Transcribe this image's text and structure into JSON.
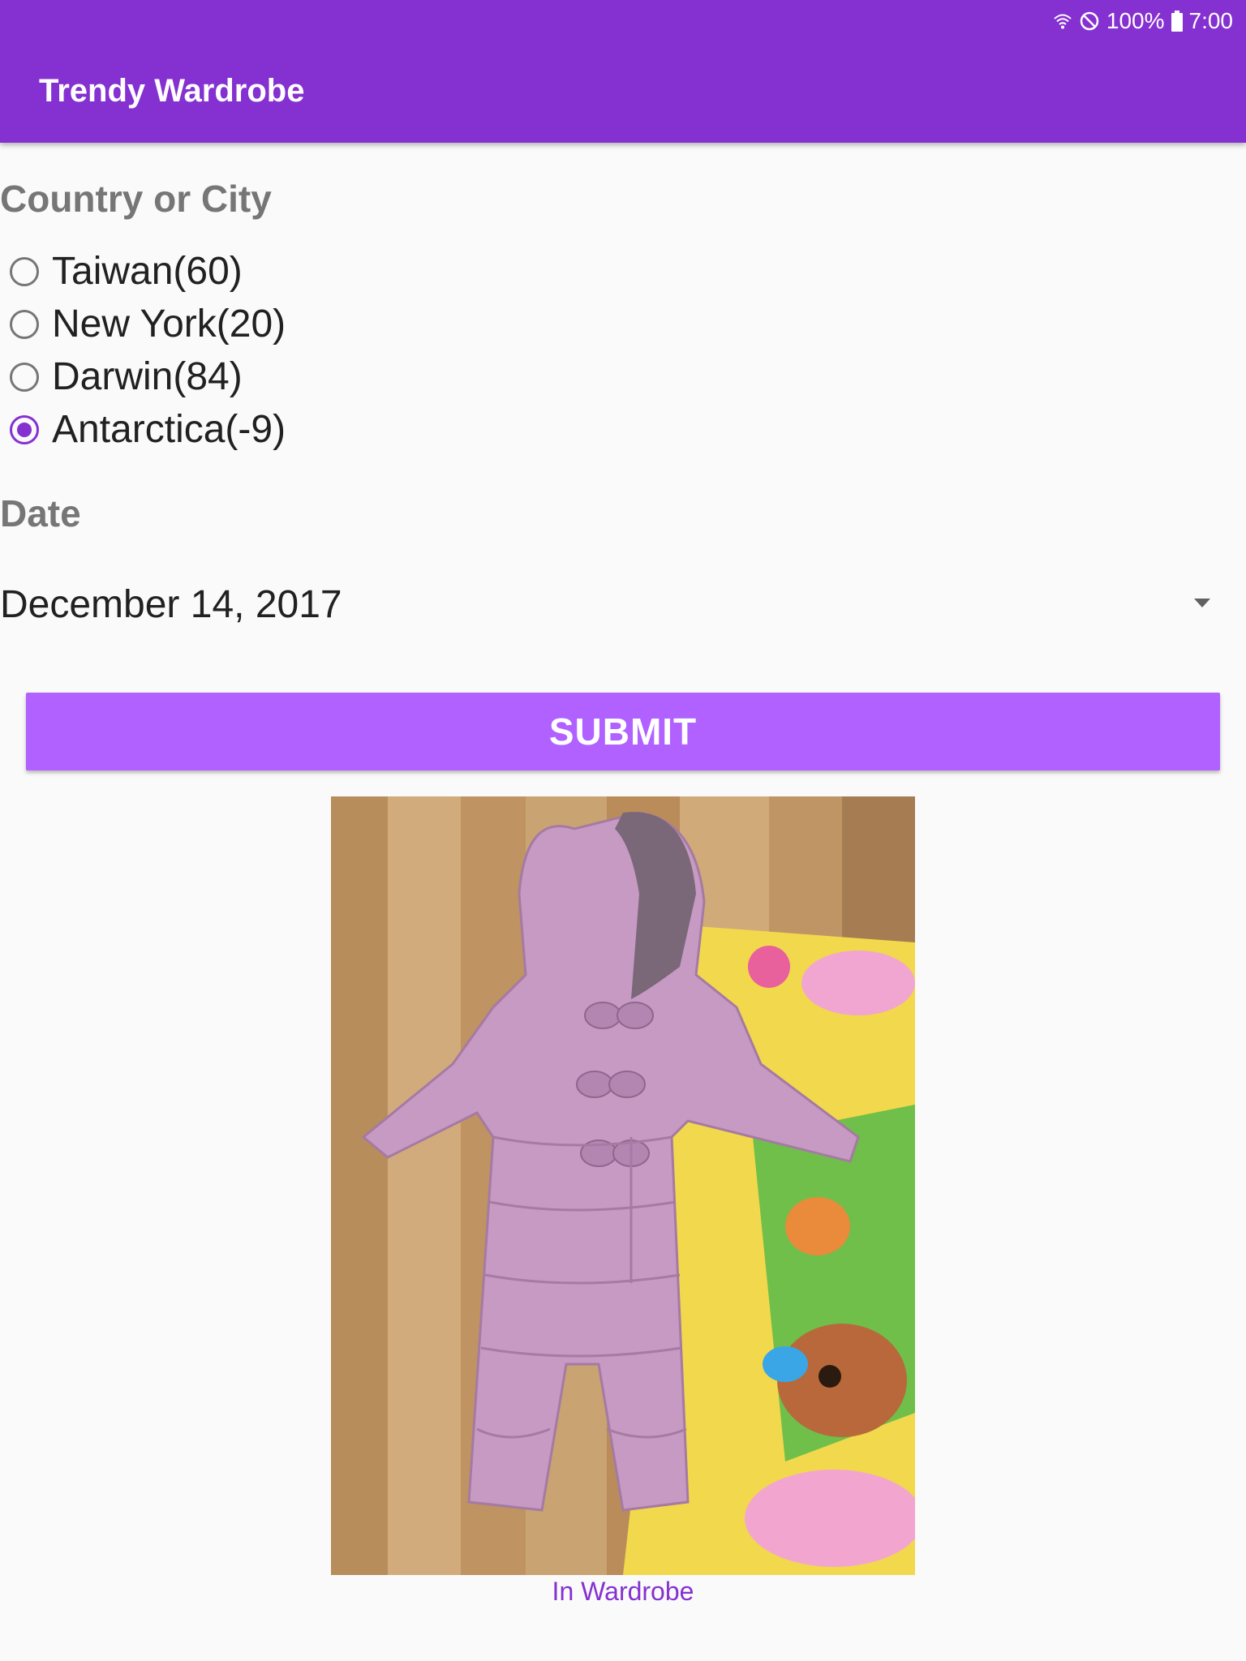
{
  "status_bar": {
    "battery": "100%",
    "time": "7:00"
  },
  "app_bar": {
    "title": "Trendy Wardrobe"
  },
  "location": {
    "label": "Country or City",
    "options": [
      {
        "label": "Taiwan(60)",
        "checked": false
      },
      {
        "label": "New York(20)",
        "checked": false
      },
      {
        "label": "Darwin(84)",
        "checked": false
      },
      {
        "label": "Antarctica(-9)",
        "checked": true
      }
    ]
  },
  "date": {
    "label": "Date",
    "value": "December 14, 2017"
  },
  "submit": {
    "label": "SUBMIT"
  },
  "result": {
    "caption": "In Wardrobe"
  },
  "colors": {
    "primary": "#8530d1",
    "button": "#b061ff",
    "background": "#fafafa"
  }
}
